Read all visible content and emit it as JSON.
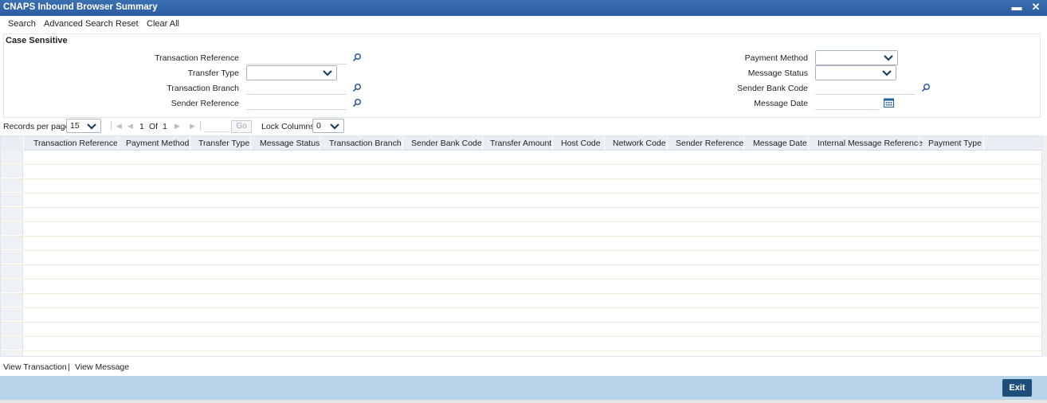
{
  "window": {
    "title": "CNAPS Inbound Browser Summary",
    "minimize_glyph": "▬",
    "close_glyph": "✕"
  },
  "toolbar": {
    "search": "Search",
    "advanced_search": "Advanced Search",
    "reset": "Reset",
    "clear_all": "Clear All"
  },
  "criteria": {
    "legend": "Case Sensitive",
    "transaction_reference": {
      "label": "Transaction Reference",
      "value": ""
    },
    "transfer_type": {
      "label": "Transfer Type",
      "value": ""
    },
    "transaction_branch": {
      "label": "Transaction Branch",
      "value": ""
    },
    "sender_reference": {
      "label": "Sender Reference",
      "value": ""
    },
    "payment_method": {
      "label": "Payment Method",
      "value": ""
    },
    "message_status": {
      "label": "Message Status",
      "value": ""
    },
    "sender_bank_code": {
      "label": "Sender Bank Code",
      "value": ""
    },
    "message_date": {
      "label": "Message Date",
      "value": ""
    }
  },
  "pager": {
    "records_label": "Records per page",
    "records_value": "15",
    "current_page": "1",
    "of_label": "Of",
    "total_pages": "1",
    "go_label": "Go",
    "lock_label": "Lock Columns",
    "lock_value": "0"
  },
  "grid": {
    "columns": [
      "Transaction Reference",
      "Payment Method",
      "Transfer Type",
      "Message Status",
      "Transaction Branch",
      "Sender Bank Code",
      "Transfer Amount",
      "Host Code",
      "Network Code",
      "Sender Reference",
      "Message Date",
      "Internal Message Reference",
      "Payment Type"
    ]
  },
  "links": {
    "view_transaction": "View Transaction",
    "separator": "|",
    "view_message": "View Message"
  },
  "footer": {
    "exit": "Exit"
  },
  "icons": {
    "search": "search-icon",
    "chevron": "chevron-down-icon",
    "calendar": "calendar-icon"
  },
  "colors": {
    "title_bar": "#2a5da0",
    "footer": "#b8d4ea",
    "exit_button": "#1e4f7a",
    "grid_header": "#e8eef4"
  }
}
